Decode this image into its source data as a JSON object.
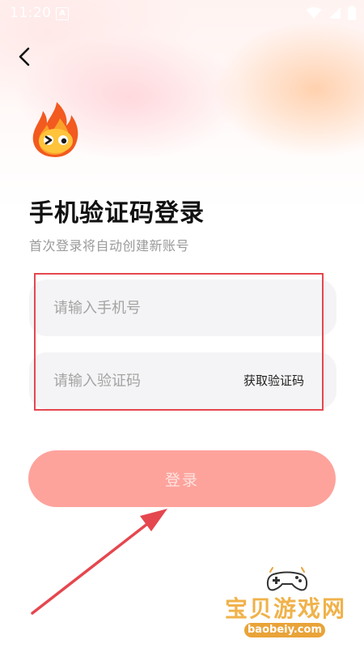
{
  "status_bar": {
    "time": "11:20",
    "notification_letter": "A",
    "icons": [
      "wifi-icon",
      "signal-icon",
      "battery-icon"
    ]
  },
  "header": {
    "back_icon": "chevron-left-icon"
  },
  "mascot": {
    "icon": "flame-mascot-icon"
  },
  "page": {
    "title": "手机验证码登录",
    "subtitle": "首次登录将自动创建新账号"
  },
  "form": {
    "phone_placeholder": "请输入手机号",
    "phone_value": "",
    "code_placeholder": "请输入验证码",
    "code_value": "",
    "get_code_label": "获取验证码",
    "login_label": "登录"
  },
  "watermark": {
    "text": "宝贝游戏网",
    "url": "baobeiy.com"
  },
  "colors": {
    "accent": "#fda39c",
    "annotation": "#e5474f",
    "watermark": "#f0b24a"
  }
}
